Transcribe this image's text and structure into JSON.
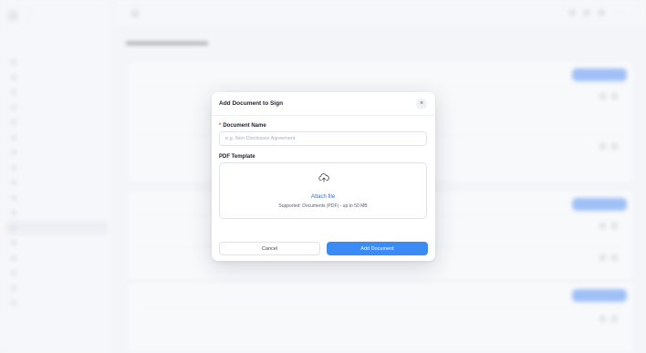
{
  "modal": {
    "title": "Add Document to Sign",
    "close_glyph": "×",
    "name_field": {
      "required_marker": "*",
      "label": "Document Name",
      "value": "",
      "placeholder": "e.g. Non-Disclosure Agreement"
    },
    "pdf_field": {
      "label": "PDF Template",
      "icon": "cloud-upload-icon",
      "attach_label": "Attach file",
      "supported_text": "Supported: Documents (PDF) - up to 50 MB"
    },
    "cancel_label": "Cancel",
    "submit_label": "Add Document"
  },
  "colors": {
    "primary": "#3b8bf6",
    "link": "#2f6fe4",
    "required": "#e5484d",
    "overlay": "#f3f4f7"
  }
}
